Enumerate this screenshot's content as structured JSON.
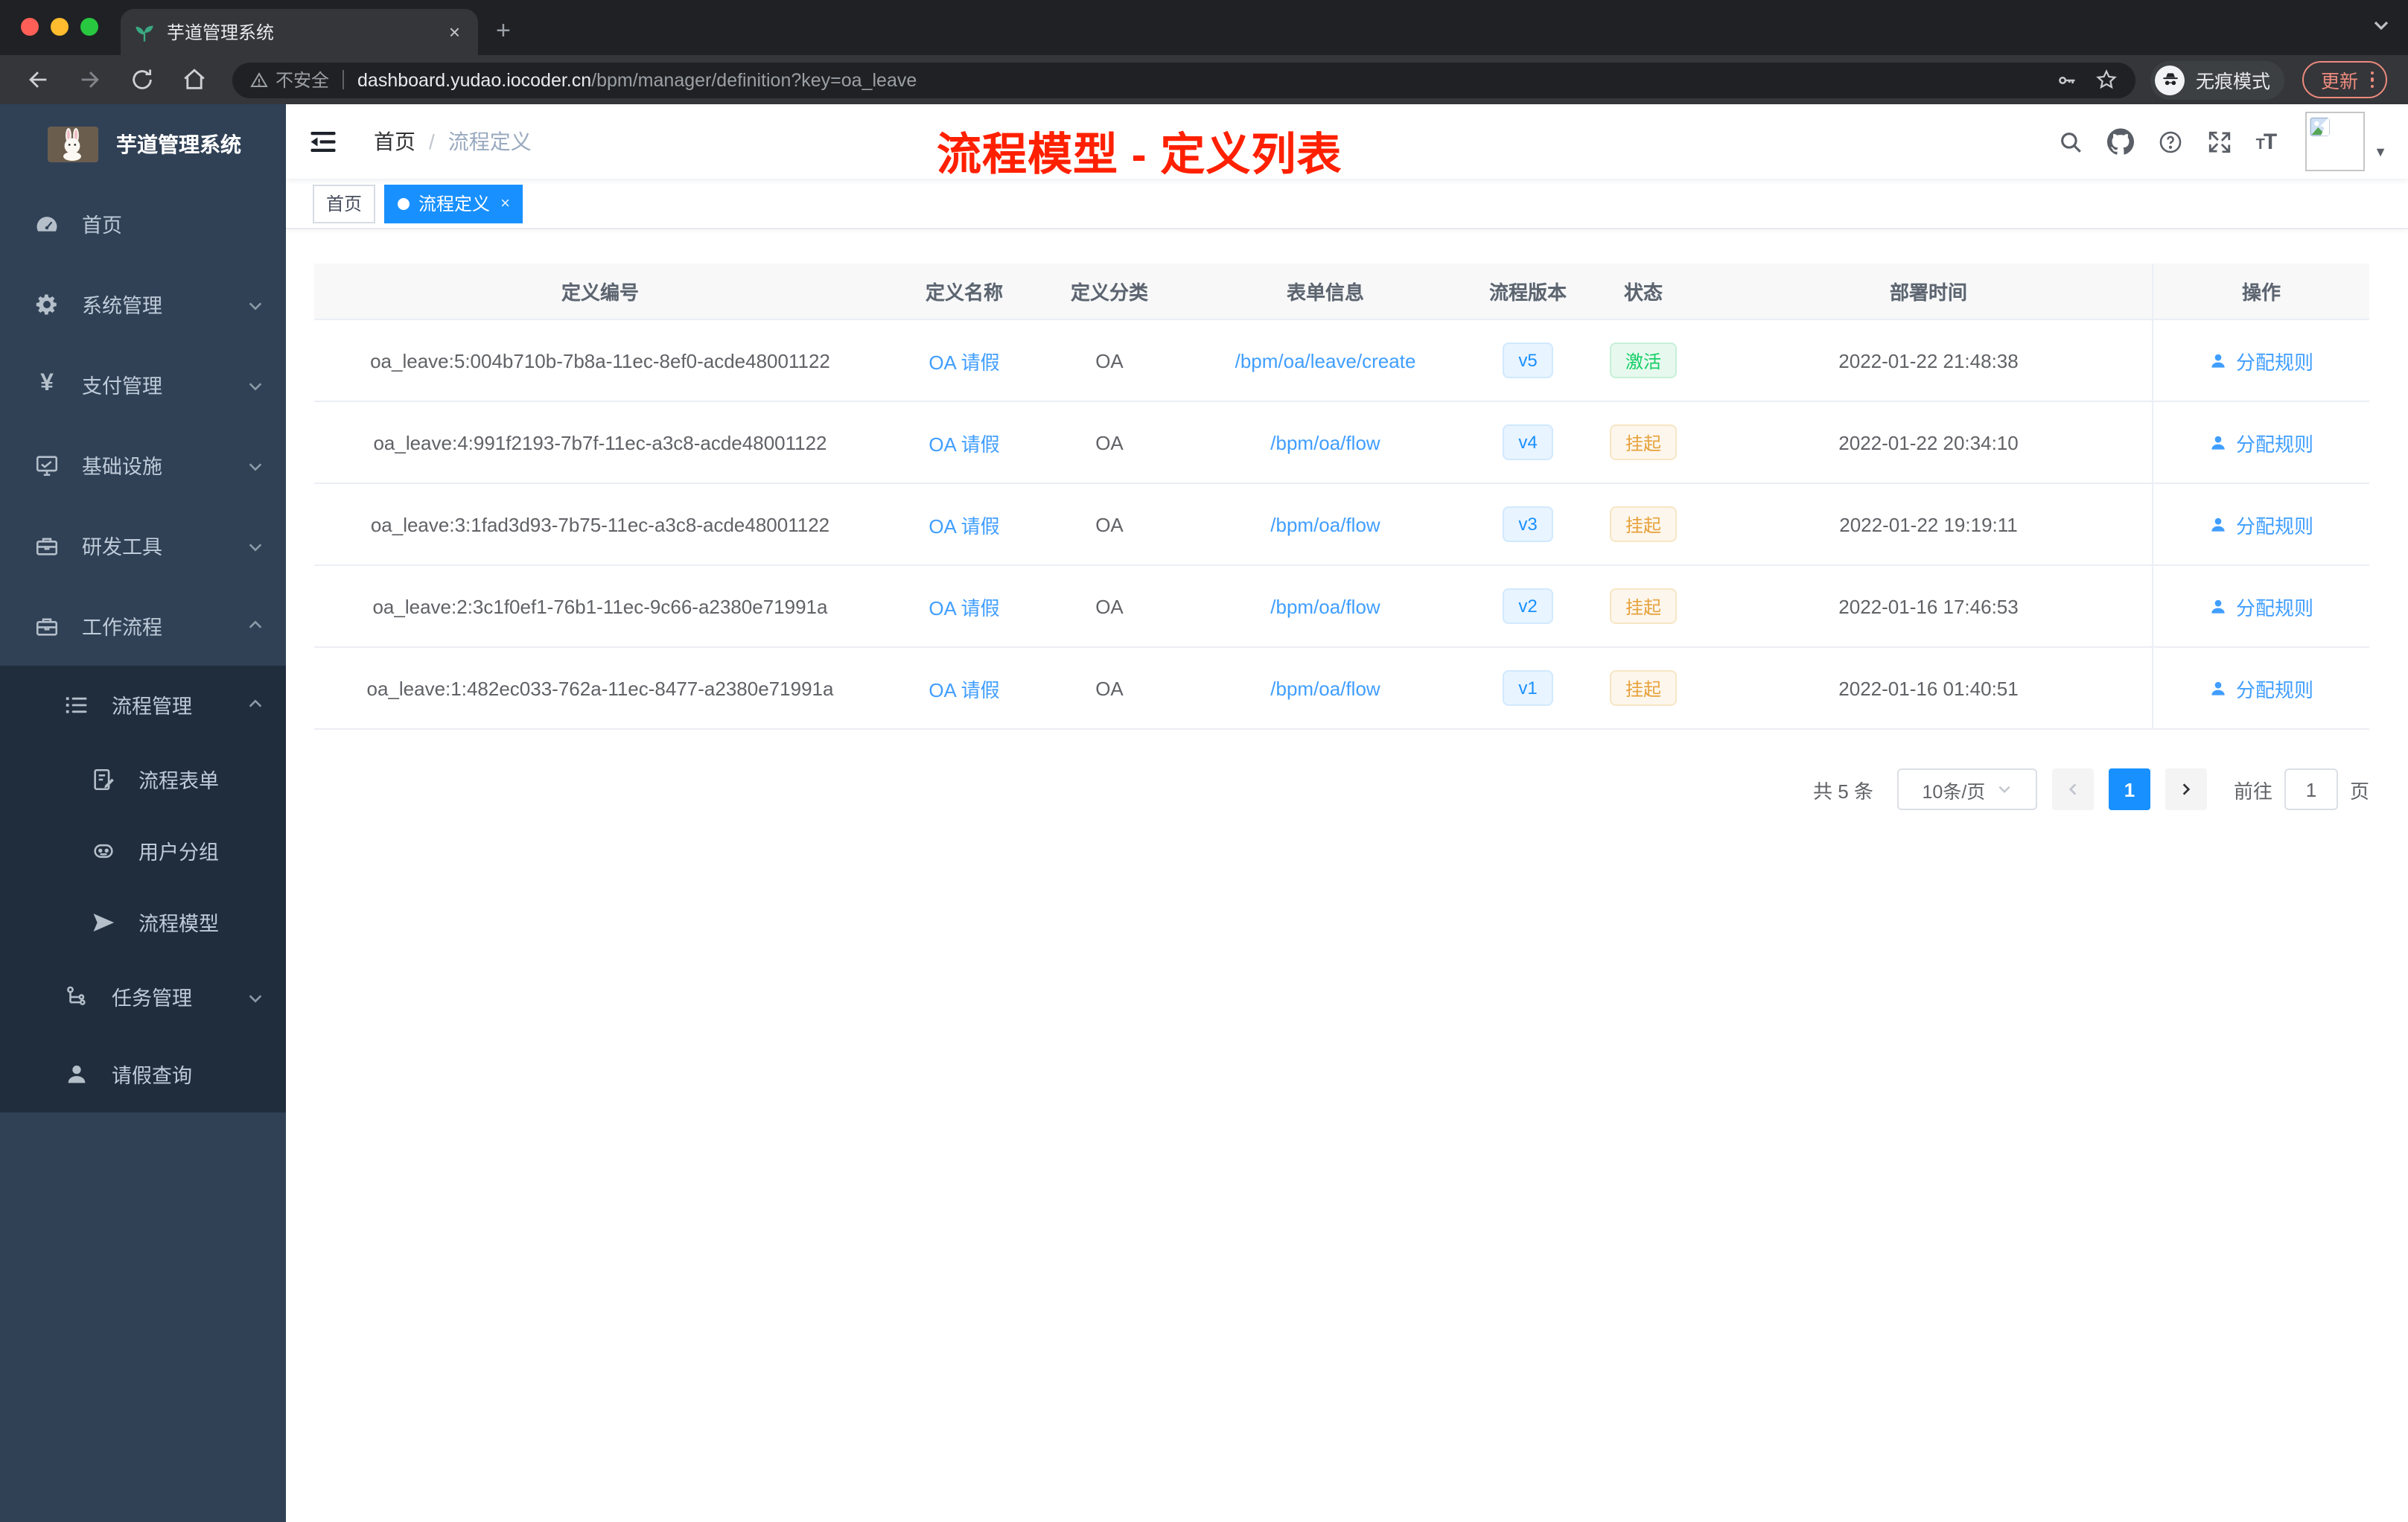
{
  "browser": {
    "tab_title": "芋道管理系统",
    "new_tab_glyph": "+",
    "close_glyph": "×",
    "security_label": "不安全",
    "url_domain": "dashboard.yudao.iocoder.cn",
    "url_path": "/bpm/manager/definition?key=oa_leave",
    "incognito_label": "无痕模式",
    "update_label": "更新"
  },
  "sidebar": {
    "app_title": "芋道管理系统",
    "items": [
      {
        "label": "首页",
        "icon": "dashboard-icon"
      },
      {
        "label": "系统管理",
        "icon": "gear-icon",
        "chevron": "down"
      },
      {
        "label": "支付管理",
        "icon": "yen-icon",
        "chevron": "down",
        "yen_glyph": "¥"
      },
      {
        "label": "基础设施",
        "icon": "monitor-icon",
        "chevron": "down"
      },
      {
        "label": "研发工具",
        "icon": "toolbox-icon",
        "chevron": "down"
      },
      {
        "label": "工作流程",
        "icon": "briefcase-icon",
        "chevron": "up"
      }
    ],
    "submenu": [
      {
        "label": "流程管理",
        "icon": "list-tree-icon",
        "chevron": "up"
      },
      {
        "label": "流程表单",
        "icon": "form-edit-icon"
      },
      {
        "label": "用户分组",
        "icon": "robot-icon"
      },
      {
        "label": "流程模型",
        "icon": "paper-plane-icon"
      },
      {
        "label": "任务管理",
        "icon": "branch-icon",
        "chevron": "down"
      },
      {
        "label": "请假查询",
        "icon": "person-icon"
      }
    ]
  },
  "navbar": {
    "breadcrumb_home": "首页",
    "breadcrumb_separator": "/",
    "breadcrumb_current": "流程定义",
    "font_size_glyph_small": "T",
    "font_size_glyph_big": "T",
    "avatar_caret_glyph": "▼"
  },
  "annotation": {
    "text": "流程模型 - 定义列表",
    "color": "#ff2000"
  },
  "tags_view": {
    "inactive_tag": "首页",
    "active_tag": "流程定义",
    "active_close_glyph": "×",
    "active_color": "#1890ff"
  },
  "table": {
    "headers": [
      "定义编号",
      "定义名称",
      "定义分类",
      "表单信息",
      "流程版本",
      "状态",
      "部署时间",
      "操作"
    ],
    "action_label": "分配规则",
    "rows": [
      {
        "id": "oa_leave:5:004b710b-7b8a-11ec-8ef0-acde48001122",
        "name": "OA 请假",
        "category": "OA",
        "form": "/bpm/oa/leave/create",
        "version": "v5",
        "status": "激活",
        "time": "2022-01-22 21:48:38",
        "action": "分配规则"
      },
      {
        "id": "oa_leave:4:991f2193-7b7f-11ec-a3c8-acde48001122",
        "name": "OA 请假",
        "category": "OA",
        "form": "/bpm/oa/flow",
        "version": "v4",
        "status": "挂起",
        "time": "2022-01-22 20:34:10",
        "action": "分配规则"
      },
      {
        "id": "oa_leave:3:1fad3d93-7b75-11ec-a3c8-acde48001122",
        "name": "OA 请假",
        "category": "OA",
        "form": "/bpm/oa/flow",
        "version": "v3",
        "status": "挂起",
        "time": "2022-01-22 19:19:11",
        "action": "分配规则"
      },
      {
        "id": "oa_leave:2:3c1f0ef1-76b1-11ec-9c66-a2380e71991a",
        "name": "OA 请假",
        "category": "OA",
        "form": "/bpm/oa/flow",
        "version": "v2",
        "status": "挂起",
        "time": "2022-01-16 17:46:53",
        "action": "分配规则"
      },
      {
        "id": "oa_leave:1:482ec033-762a-11ec-8477-a2380e71991a",
        "name": "OA 请假",
        "category": "OA",
        "form": "/bpm/oa/flow",
        "version": "v1",
        "status": "挂起",
        "time": "2022-01-16 01:40:51",
        "action": "分配规则"
      }
    ],
    "status_colors": {
      "active_green": "#13ce66",
      "suspended_orange": "#e6a23c",
      "version_blue": "#1890ff"
    }
  },
  "pagination": {
    "total": "共 5 条",
    "page_size": "10条/页",
    "current_page": "1",
    "goto_label": "前往",
    "goto_value": "1",
    "page_unit": "页"
  }
}
